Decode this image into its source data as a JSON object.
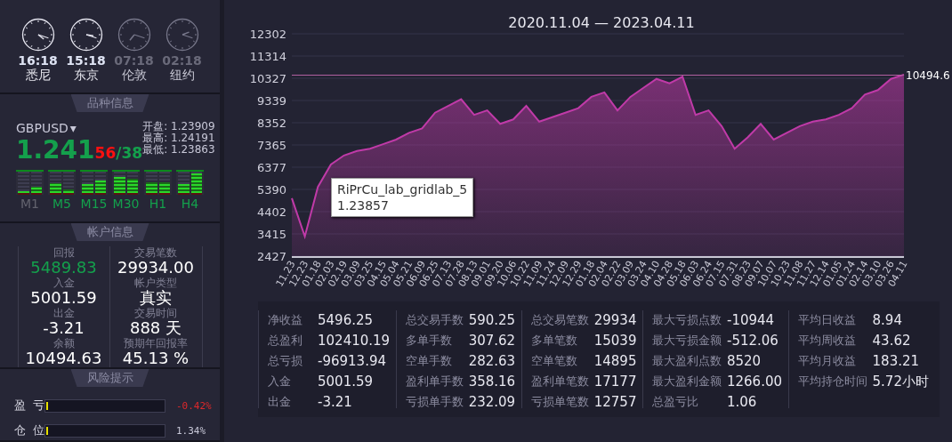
{
  "clocks": [
    {
      "time": "16:18",
      "city": "悉尼",
      "dimmed": false
    },
    {
      "time": "15:18",
      "city": "东京",
      "dimmed": false
    },
    {
      "time": "07:18",
      "city": "伦敦",
      "dimmed": true
    },
    {
      "time": "02:18",
      "city": "纽约",
      "dimmed": true
    }
  ],
  "symbol": {
    "header": "品种信息",
    "name": "GBPUSD",
    "caret": "▾",
    "price_big": "1.241",
    "price_mid": "56",
    "price_tail": "/38",
    "quotes": [
      {
        "label": "开盘:",
        "value": "1.23909"
      },
      {
        "label": "最高:",
        "value": "1.24191"
      },
      {
        "label": "最低:",
        "value": "1.23863"
      }
    ],
    "meters": [
      {
        "label": "M1",
        "active": false,
        "bars": [
          {
            "level": 0.1
          },
          {
            "level": 0.3
          }
        ]
      },
      {
        "label": "M5",
        "active": true,
        "bars": [
          {
            "level": 0.45
          },
          {
            "level": 0.15
          }
        ]
      },
      {
        "label": "M15",
        "active": true,
        "bars": [
          {
            "level": 0.4
          },
          {
            "level": 0.6
          }
        ]
      },
      {
        "label": "M30",
        "active": true,
        "bars": [
          {
            "level": 0.75
          },
          {
            "level": 0.65
          }
        ]
      },
      {
        "label": "H1",
        "active": true,
        "bars": [
          {
            "level": 0.5
          },
          {
            "level": 0.5
          }
        ]
      },
      {
        "label": "H4",
        "active": true,
        "bars": [
          {
            "level": 0.4
          },
          {
            "level": 0.9
          }
        ]
      }
    ]
  },
  "account": {
    "header": "帐户信息",
    "items": [
      {
        "label": "回报",
        "value": "5489.83",
        "color": "#14a04c"
      },
      {
        "label": "交易笔数",
        "value": "29934.00",
        "color": "#ffffff"
      },
      {
        "label": "入金",
        "value": "5001.59",
        "color": "#ffffff"
      },
      {
        "label": "帐户类型",
        "value": "真实",
        "color": "#ffffff"
      },
      {
        "label": "出金",
        "value": "-3.21",
        "color": "#ffffff"
      },
      {
        "label": "交易时间",
        "value": "888 天",
        "color": "#ffffff"
      },
      {
        "label": "余额",
        "value": "10494.63",
        "color": "#ffffff"
      },
      {
        "label": "预期年回报率",
        "value": "45.13 %",
        "color": "#ffffff"
      }
    ]
  },
  "risk": {
    "header": "风险提示",
    "rows": [
      {
        "label": "盈  亏",
        "level": 0.01,
        "value": "-0.42%",
        "color": "#e0282a"
      },
      {
        "label": "仓  位",
        "level": 0.01,
        "value": "1.34%",
        "color": "#c8c8d8"
      }
    ]
  },
  "chart": {
    "tooltip": {
      "value": "1.23857"
    },
    "last_value_label": "10494.6",
    "chart_data": {
      "type": "area",
      "title": "2020.11.04 — 2023.04.11",
      "categories": [
        "11.23",
        "12.23",
        "01.18",
        "02.03",
        "02.19",
        "03.09",
        "03.25",
        "04.15",
        "05.04",
        "05.21",
        "06.09",
        "06.25",
        "07.13",
        "07.28",
        "08.13",
        "09.01",
        "09.20",
        "10.06",
        "10.22",
        "11.09",
        "11.24",
        "12.09",
        "12.29",
        "01.18",
        "02.04",
        "02.22",
        "03.09",
        "03.24",
        "04.10",
        "04.28",
        "05.18",
        "06.03",
        "06.24",
        "07.15",
        "07.31",
        "08.23",
        "09.07",
        "10.07",
        "10.23",
        "11.08",
        "11.27",
        "12.14",
        "01.05",
        "01.24",
        "02.14",
        "03.10",
        "03.26",
        "04.11"
      ],
      "series": [
        {
          "name": "RiPrCu_lab_gridlab_5",
          "color": "#c03aa8",
          "values": [
            5000,
            3300,
            5500,
            6500,
            6900,
            7100,
            7200,
            7400,
            7600,
            7900,
            8100,
            8800,
            9100,
            9400,
            8700,
            8900,
            8300,
            8500,
            9100,
            8400,
            8600,
            8800,
            9000,
            9500,
            9700,
            8900,
            9500,
            9900,
            10300,
            10100,
            10400,
            8700,
            8900,
            8200,
            7200,
            7700,
            8300,
            7600,
            7900,
            8200,
            8400,
            8500,
            8700,
            9000,
            9600,
            9800,
            10300,
            10490
          ]
        }
      ],
      "ylim": [
        2427,
        12302
      ],
      "yticks": [
        12302,
        11314,
        10327,
        9339,
        8352,
        7365,
        6377,
        5390,
        4402,
        3415,
        2427
      ],
      "grid": true
    }
  },
  "stats": [
    [
      {
        "label": "净收益",
        "value": "5496.25"
      },
      {
        "label": "总盈利",
        "value": "102410.19"
      },
      {
        "label": "总亏损",
        "value": "-96913.94"
      },
      {
        "label": "入金",
        "value": "5001.59"
      },
      {
        "label": "出金",
        "value": "-3.21"
      }
    ],
    [
      {
        "label": "总交易手数",
        "value": "590.25"
      },
      {
        "label": "多单手数",
        "value": "307.62"
      },
      {
        "label": "空单手数",
        "value": "282.63"
      },
      {
        "label": "盈利单手数",
        "value": "358.16"
      },
      {
        "label": "亏损单手数",
        "value": "232.09"
      }
    ],
    [
      {
        "label": "总交易笔数",
        "value": "29934"
      },
      {
        "label": "多单笔数",
        "value": "15039"
      },
      {
        "label": "空单笔数",
        "value": "14895"
      },
      {
        "label": "盈利单笔数",
        "value": "17177"
      },
      {
        "label": "亏损单笔数",
        "value": "12757"
      }
    ],
    [
      {
        "label": "最大亏损点数",
        "value": "-10944"
      },
      {
        "label": "最大亏损金额",
        "value": "-512.06"
      },
      {
        "label": "最大盈利点数",
        "value": "8520"
      },
      {
        "label": "最大盈利金额",
        "value": "1266.00"
      },
      {
        "label": "总盈亏比",
        "value": "1.06"
      }
    ],
    [
      {
        "label": "平均日收益",
        "value": "8.94"
      },
      {
        "label": "平均周收益",
        "value": "43.62"
      },
      {
        "label": "平均月收益",
        "value": "183.21"
      },
      {
        "label": "平均持仓时间",
        "value": "5.72小时"
      }
    ]
  ]
}
